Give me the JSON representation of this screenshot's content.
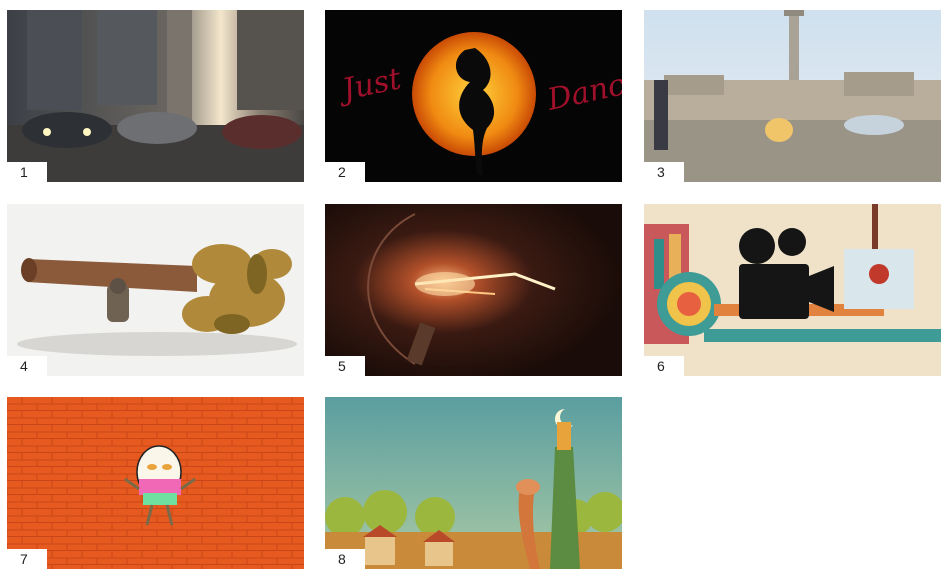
{
  "gallery": {
    "tiles": [
      {
        "number": "1",
        "subject": "street-scene-with-cars"
      },
      {
        "number": "2",
        "subject": "just-dance-poster",
        "left_script": "Just",
        "right_script": "Dance"
      },
      {
        "number": "3",
        "subject": "city-square-with-monument"
      },
      {
        "number": "4",
        "subject": "creature-carrying-log"
      },
      {
        "number": "5",
        "subject": "lightbulb-filament-spark"
      },
      {
        "number": "6",
        "subject": "retro-film-camera-illustration"
      },
      {
        "number": "7",
        "subject": "humpty-dumpty-on-brick-wall"
      },
      {
        "number": "8",
        "subject": "whimsical-town-with-tall-creatures"
      }
    ]
  }
}
